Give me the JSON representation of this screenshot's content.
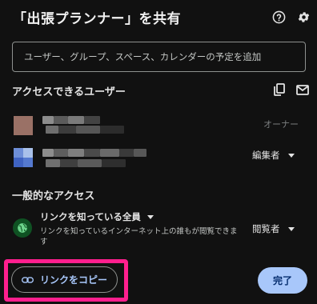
{
  "dialog": {
    "title": "「出張プランナー」を共有",
    "add_placeholder": "ユーザー、グループ、スペース、カレンダーの予定を追加"
  },
  "users_section": {
    "label": "アクセスできるユーザー",
    "users": [
      {
        "name": "",
        "role": "オーナー",
        "avatar_color": "#9a7166"
      },
      {
        "name": "",
        "role": "編集者",
        "avatar_color": "#4a6ec8"
      }
    ]
  },
  "general_access": {
    "label": "一般的なアクセス",
    "setting": "リンクを知っている全員",
    "description": "リンクを知っているインターネット上の誰もが閲覧できます",
    "role": "閲覧者"
  },
  "footer": {
    "copy_link": "リンクをコピー",
    "done": "完了"
  },
  "icons": {
    "help": "help-icon",
    "settings": "settings-icon",
    "copy": "copy-icon",
    "mail": "mail-icon",
    "globe": "globe-icon",
    "link": "link-icon"
  },
  "colors": {
    "background": "#111111",
    "accent": "#a8c7fa",
    "highlight": "#ff1f8e",
    "globe_bg": "#0f5223"
  }
}
